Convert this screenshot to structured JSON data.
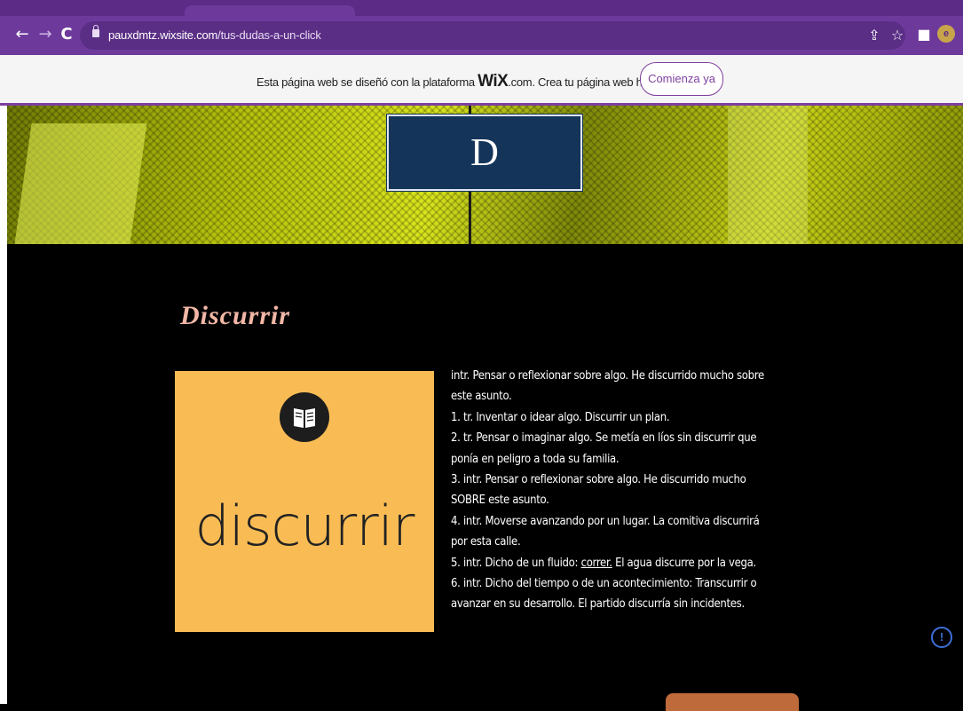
{
  "browser": {
    "url_domain": "pauxdmtz.wixsite.com",
    "url_path": "/tus-dudas-a-un-click",
    "back_icon": "arrow-left-icon",
    "forward_icon": "arrow-right-icon",
    "reload_icon": "reload-icon",
    "share_icon": "share-icon",
    "star_icon": "star-icon",
    "sidepanel_icon": "sidepanel-icon",
    "avatar_letter": "e"
  },
  "wix_banner": {
    "text_before": "Esta página web se diseñó con la plataforma ",
    "logo": "WiX",
    "text_after": ".com. Crea tu página web hoy.",
    "button_label": "Comienza ya"
  },
  "hero": {
    "logo_letter": "D"
  },
  "main": {
    "title": "Discurrir",
    "image_word": "discurrir",
    "definition": {
      "intro": " intr. Pensar o reflexionar sobre algo. He discurrido mucho sobre este asunto.",
      "item1": "1. tr. Inventar o idear algo. Discurrir un plan.",
      "item2": "2. tr. Pensar o imaginar algo. Se metía en líos sin discurrir que ponía en peligro a toda su familia.",
      "item3": "3. intr. Pensar o reflexionar sobre algo. He discurrido mucho SOBRE este asunto.",
      "item4": "4. intr. Moverse avanzando por un lugar. La comitiva discurrirá por esta calle.",
      "item5_before": "5. intr. Dicho de un fluido: ",
      "item5_link": "correr.",
      "item5_after": " El agua discurre por la vega.",
      "item6": "6. intr. Dicho del tiempo o de un acontecimiento: Transcurrir o avanzar en su desarrollo. El partido discurría sin incidentes."
    }
  },
  "colors": {
    "browser_purple": "#6d3a9c",
    "title_pink": "#f2b7a6",
    "card_yellow": "#f9bc55",
    "logo_navy": "#14345a"
  }
}
